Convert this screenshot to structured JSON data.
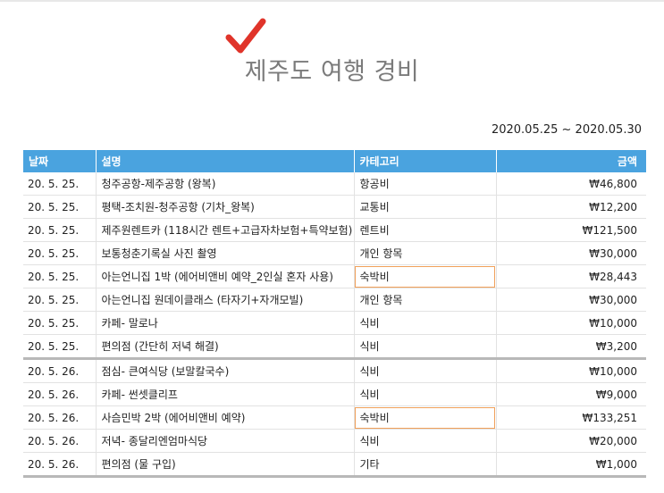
{
  "document": {
    "title": "제주도 여행 경비",
    "date_range": "2020.05.25 ~ 2020.05.30",
    "colors": {
      "header_bg": "#4aa3df",
      "checkmark": "#e0342a",
      "highlight_border": "#f0a05a"
    },
    "icons": {
      "title_mark": "checkmark-icon"
    }
  },
  "table": {
    "headers": {
      "date": "날짜",
      "description": "설명",
      "category": "카테고리",
      "amount": "금액"
    },
    "rows": [
      {
        "date": "20. 5. 25.",
        "description": "청주공항-제주공항 (왕복)",
        "category": "항공비",
        "amount": "₩46,800"
      },
      {
        "date": "20. 5. 25.",
        "description": "평택-조치원-청주공항 (기차_왕복)",
        "category": "교통비",
        "amount": "₩12,200"
      },
      {
        "date": "20. 5. 25.",
        "description": "제주원렌트카 (118시간 렌트+고급자차보험+특약보험)",
        "category": "렌트비",
        "amount": "₩121,500"
      },
      {
        "date": "20. 5. 25.",
        "description": "보통청춘기록실 사진 촬영",
        "category": "개인 항목",
        "amount": "₩30,000"
      },
      {
        "date": "20. 5. 25.",
        "description": "아는언니집 1박 (에어비앤비 예약_2인실 혼자 사용)",
        "category": "숙박비",
        "amount": "₩28,443"
      },
      {
        "date": "20. 5. 25.",
        "description": "아는언니집 원데이클래스 (타자기+자개모빌)",
        "category": "개인 항목",
        "amount": "₩30,000"
      },
      {
        "date": "20. 5. 25.",
        "description": "카페- 말로나",
        "category": "식비",
        "amount": "₩10,000"
      },
      {
        "date": "20. 5. 25.",
        "description": "편의점 (간단히 저녁 해결)",
        "category": "식비",
        "amount": "₩3,200"
      },
      {
        "date": "20. 5. 26.",
        "description": "점심- 큰여식당 (보말칼국수)",
        "category": "식비",
        "amount": "₩10,000"
      },
      {
        "date": "20. 5. 26.",
        "description": "카페- 썬셋클리프",
        "category": "식비",
        "amount": "₩9,000"
      },
      {
        "date": "20. 5. 26.",
        "description": "사슴민박 2박 (에어비앤비 예약)",
        "category": "숙박비",
        "amount": "₩133,251"
      },
      {
        "date": "20. 5. 26.",
        "description": "저녁- 종달리엔엄마식당",
        "category": "식비",
        "amount": "₩20,000"
      },
      {
        "date": "20. 5. 26.",
        "description": "편의점 (물 구입)",
        "category": "기타",
        "amount": "₩1,000"
      }
    ]
  }
}
